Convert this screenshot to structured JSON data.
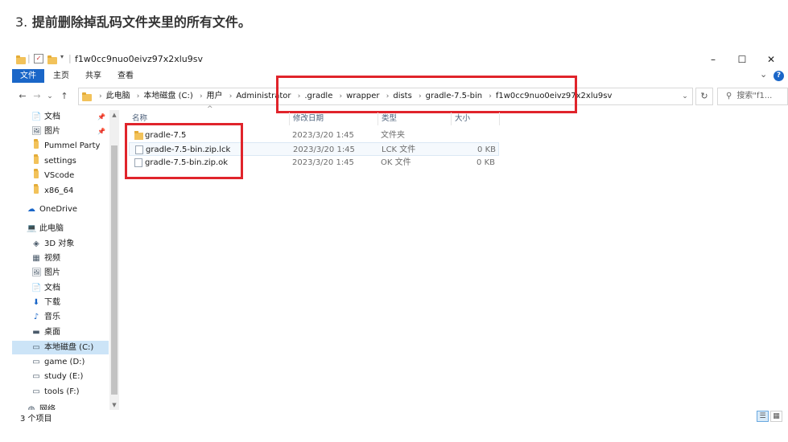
{
  "article": {
    "step_number": "3.",
    "step_text": "提前删除掉乱码文件夹里的所有文件。"
  },
  "window": {
    "title": "f1w0cc9nuo0eivz97x2xlu9sv",
    "controls": {
      "minimize": "–",
      "maximize": "☐",
      "close": "✕"
    }
  },
  "ribbon": {
    "tabs": [
      "文件",
      "主页",
      "共享",
      "查看"
    ],
    "collapse_glyph": "⌄",
    "help_glyph": "?"
  },
  "nav": {
    "back": "←",
    "forward": "→",
    "recent": "⌄",
    "up": "↑",
    "breadcrumbs": [
      "此电脑",
      "本地磁盘 (C:)",
      "用户",
      "Administrator",
      ".gradle",
      "wrapper",
      "dists",
      "gradle-7.5-bin",
      "f1w0cc9nuo0eivz97x2xlu9sv"
    ],
    "search_placeholder": "搜索\"f1..."
  },
  "sidebar": {
    "items": [
      {
        "label": "文档",
        "icon": "document-icon",
        "glyph": "📄",
        "pinned": true
      },
      {
        "label": "图片",
        "icon": "picture-icon",
        "glyph": "🖼",
        "pinned": true
      },
      {
        "label": "Pummel Party",
        "icon": "folder-icon",
        "glyph": "",
        "pinned": false
      },
      {
        "label": "settings",
        "icon": "folder-icon",
        "glyph": "",
        "pinned": false
      },
      {
        "label": "VScode",
        "icon": "folder-icon",
        "glyph": "",
        "pinned": false
      },
      {
        "label": "x86_64",
        "icon": "folder-icon",
        "glyph": "",
        "pinned": false
      },
      {
        "label": "OneDrive",
        "icon": "cloud-icon",
        "glyph": "☁",
        "pinned": false
      },
      {
        "label": "此电脑",
        "icon": "computer-icon",
        "glyph": "💻",
        "pinned": false
      },
      {
        "label": "3D 对象",
        "icon": "cube-icon",
        "glyph": "◈",
        "pinned": false
      },
      {
        "label": "视频",
        "icon": "video-icon",
        "glyph": "▦",
        "pinned": false
      },
      {
        "label": "图片",
        "icon": "picture-icon",
        "glyph": "🖼",
        "pinned": false
      },
      {
        "label": "文档",
        "icon": "document-icon",
        "glyph": "📄",
        "pinned": false
      },
      {
        "label": "下载",
        "icon": "download-icon",
        "glyph": "⬇",
        "pinned": false
      },
      {
        "label": "音乐",
        "icon": "music-icon",
        "glyph": "♪",
        "pinned": false
      },
      {
        "label": "桌面",
        "icon": "desktop-icon",
        "glyph": "▬",
        "pinned": false
      },
      {
        "label": "本地磁盘 (C:)",
        "icon": "drive-icon",
        "glyph": "▭",
        "pinned": false,
        "selected": true
      },
      {
        "label": "game (D:)",
        "icon": "drive-icon",
        "glyph": "▭",
        "pinned": false
      },
      {
        "label": "study (E:)",
        "icon": "drive-icon",
        "glyph": "▭",
        "pinned": false
      },
      {
        "label": "tools (F:)",
        "icon": "drive-icon",
        "glyph": "▭",
        "pinned": false
      },
      {
        "label": "网络",
        "icon": "network-icon",
        "glyph": "◍",
        "pinned": false
      }
    ]
  },
  "columns": {
    "name": "名称",
    "date": "修改日期",
    "type": "类型",
    "size": "大小",
    "sort_glyph": "^"
  },
  "files": [
    {
      "name": "gradle-7.5",
      "date": "2023/3/20 1:45",
      "type": "文件夹",
      "size": "",
      "kind": "folder"
    },
    {
      "name": "gradle-7.5-bin.zip.lck",
      "date": "2023/3/20 1:45",
      "type": "LCK 文件",
      "size": "0 KB",
      "kind": "file"
    },
    {
      "name": "gradle-7.5-bin.zip.ok",
      "date": "2023/3/20 1:45",
      "type": "OK 文件",
      "size": "0 KB",
      "kind": "file"
    }
  ],
  "status": {
    "count_text": "3 个项目"
  },
  "colors": {
    "highlight_red": "#e0242b",
    "ribbon_file_blue": "#1a66c8",
    "folder_yellow": "#f2c25a"
  }
}
